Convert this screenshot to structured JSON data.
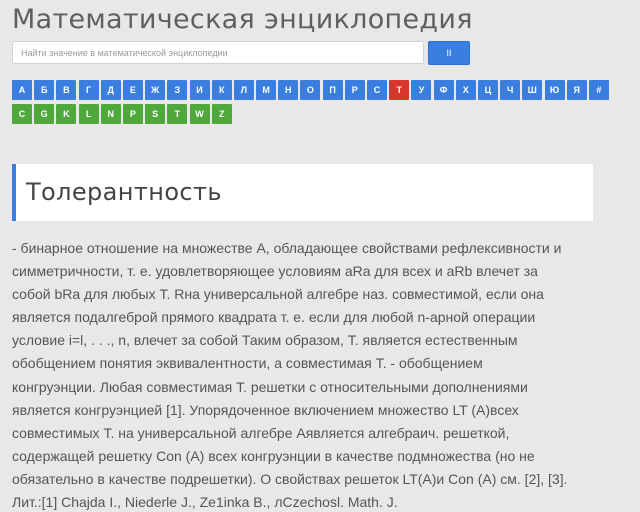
{
  "site": {
    "title": "Математическая энциклопедия"
  },
  "search": {
    "placeholder": "Найти значение в математической энциклопедии",
    "value": "",
    "button_label": "II"
  },
  "alphabet": {
    "row1": [
      "А",
      "Б",
      "В",
      "Г",
      "Д",
      "Е",
      "Ж",
      "З",
      "И",
      "К",
      "Л",
      "М",
      "Н",
      "О",
      "П",
      "Р",
      "С",
      "Т",
      "У",
      "Ф",
      "Х",
      "Ц",
      "Ч",
      "Ш",
      "Ю",
      "Я",
      "#"
    ],
    "row2": [
      "C",
      "G",
      "K",
      "L",
      "N",
      "P",
      "S",
      "T",
      "W",
      "Z"
    ],
    "active": "Т",
    "colors": {
      "blue": "#3a7fe0",
      "green": "#4ea83c",
      "active": "#d9362b"
    }
  },
  "article": {
    "title": "Толерантность",
    "lines": [
      "- бинарное отношение на множестве А, обладающее свойствами рефлексивности и",
      "симметричности, т. е. удовлетворяющее условиям аRа для всех и аRb влечет за",
      "собой bRа для любых Т. Rна универсальной алгебре наз. совместимой, если она",
      "является подалгеброй прямого квадрата т. е. если для любой n-арной операции",
      "условие i=l, . . ., n, влечет за собой Таким образом, Т. является естественным",
      "обобщением понятия эквивалентности, а совместимая Т. - обобщением",
      "конгруэнции. Любая совместимая Т. решетки с относительными дополнениями",
      "является конгруэнцией [1]. Упорядоченное включением множество LT (A)всех",
      "совместимых Т. на универсальной алгебре Аявляется алгебраич. решеткой,",
      "содержащей решетку Con (А) всех конгруэнции в качестве подмножества (но не",
      "обязательно в качестве подрешетки). О свойствах решеток LT(A)и Con (А) см. [2], [3].",
      "Лит.:[1] Chajda I., Niederle J., Ze1inka В., лCzechosl. Math. J."
    ]
  }
}
